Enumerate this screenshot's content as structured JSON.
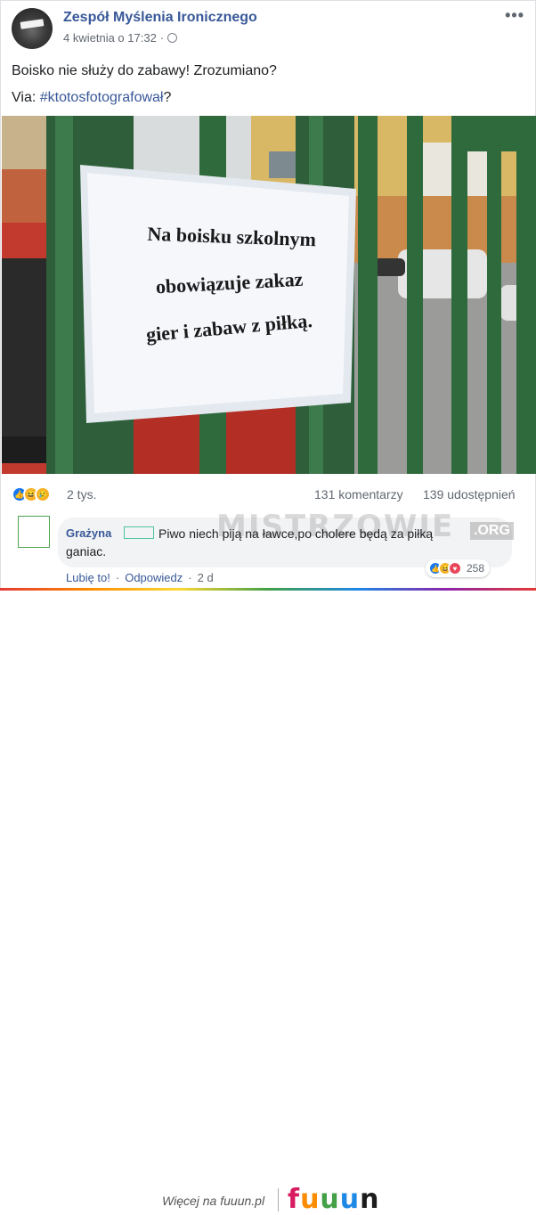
{
  "post": {
    "page_name": "Zespół Myślenia Ironicznego",
    "timestamp": "4 kwietnia o 17:32",
    "separator": "·",
    "more_label": "•••",
    "text_line1": "Boisko nie służy do zabawy! Zrozumiano?",
    "via_label": "Via: ",
    "hashtag": "#ktotosfotografował",
    "via_suffix": "?"
  },
  "photo": {
    "sign_line1": "Na boisku szkolnym",
    "sign_line2": "obowiązuje zakaz",
    "sign_line3": "gier i zabaw z piłką."
  },
  "stats": {
    "reactions": "2 tys.",
    "comments": "131 komentarzy",
    "shares": "139 udostępnień"
  },
  "comment": {
    "author": "Grażyna",
    "text_line1": "Piwo niech piją na ławce,po cholere będą za piłką",
    "text_line2": "ganiac.",
    "like_label": "Lubię to!",
    "reply_label": "Odpowiedz",
    "age": "2 d",
    "sep": "·",
    "reaction_count": "258"
  },
  "watermark": {
    "text": "MISTRZOWIE",
    "suffix": ".ORG"
  },
  "footer": {
    "more_text": "Więcej na fuuun.pl",
    "logo_letters": [
      "f",
      "u",
      "u",
      "u",
      "n"
    ],
    "logo_colors": [
      "#d81b60",
      "#fb8c00",
      "#43a047",
      "#1e88e5",
      "#1c1c1c"
    ]
  },
  "colors": {
    "link": "#385898",
    "like_blue": "#1877f2"
  },
  "icons": {
    "privacy": "globe-icon",
    "reactions": [
      "like-icon",
      "haha-icon",
      "sad-icon"
    ],
    "comment_reactions": [
      "like-icon",
      "haha-icon",
      "love-icon"
    ]
  }
}
